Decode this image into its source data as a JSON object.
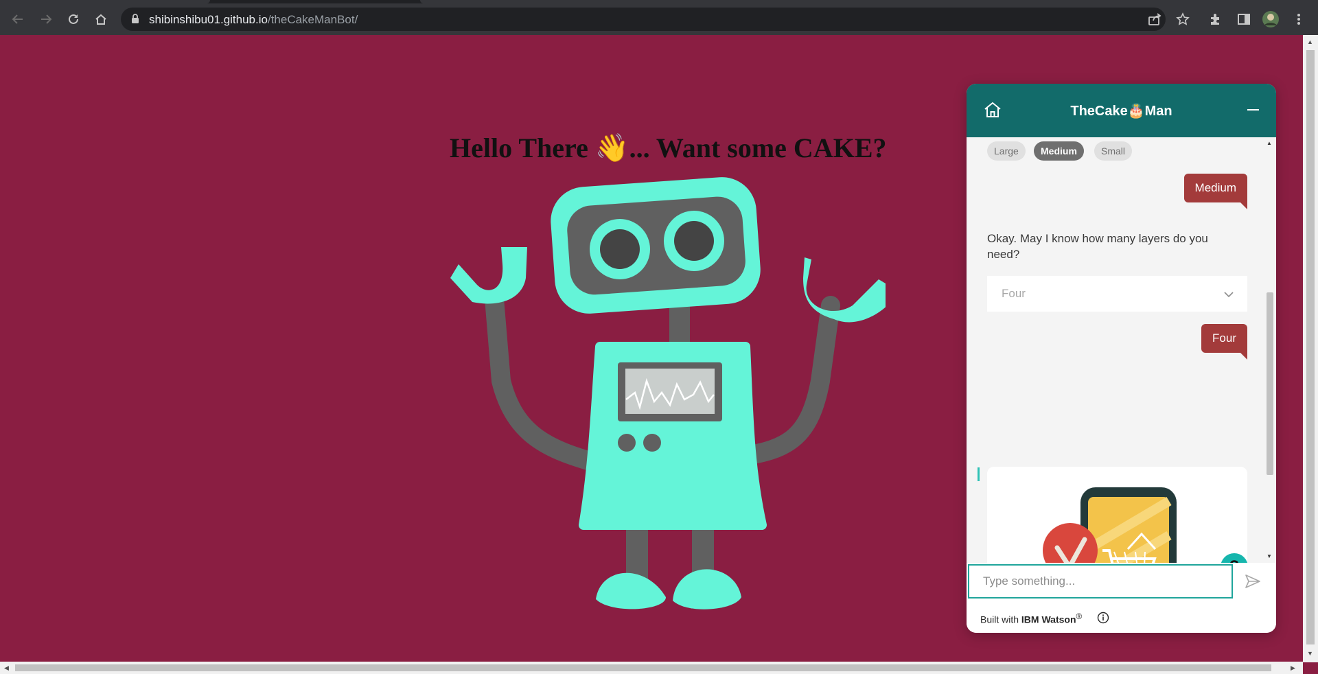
{
  "browser": {
    "url_host": "shibinshibu01.github.io",
    "url_path": "/theCakeManBot/"
  },
  "page": {
    "headline_before": "Hello There ",
    "headline_emoji": "👋",
    "headline_after": "... Want some CAKE?",
    "background_color": "#8a1e42",
    "illustration": "robot-illustration"
  },
  "chat": {
    "title_before": "TheCake",
    "title_emoji": "🎂",
    "title_after": "Man",
    "header_color": "#126b6a",
    "size_options": [
      "Large",
      "Medium",
      "Small"
    ],
    "selected_size": "Medium",
    "user_reply_1": "Medium",
    "bot_question": "Okay. May I know how many layers do you need?",
    "layers_dropdown_value": "Four",
    "user_reply_2": "Four",
    "card_image": "shopping-confirmation-illustration",
    "help_label": "?",
    "input_placeholder": "Type something...",
    "footer_prefix": "Built with ",
    "footer_brand": "IBM Watson",
    "footer_reg": "®",
    "user_bubble_color": "#a33b3b"
  }
}
